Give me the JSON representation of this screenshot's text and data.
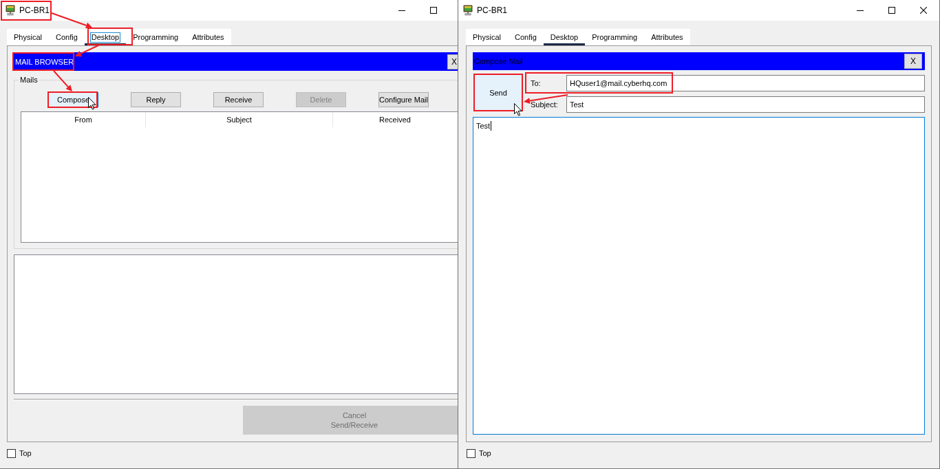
{
  "windows": [
    {
      "title": "PC-BR1",
      "partly_covered": true,
      "tabs": [
        {
          "label": "Physical",
          "selected": false,
          "focused": false
        },
        {
          "label": "Config",
          "selected": false,
          "focused": false
        },
        {
          "label": "Desktop",
          "selected": true,
          "focused": true
        },
        {
          "label": "Programming",
          "selected": false,
          "focused": false
        },
        {
          "label": "Attributes",
          "selected": false,
          "focused": false
        }
      ],
      "app": {
        "kind": "mail_browser",
        "title": "MAIL BROWSER",
        "close_label": "X",
        "group_label": "Mails",
        "buttons": [
          {
            "label": "Compose",
            "disabled": false,
            "hovered": true
          },
          {
            "label": "Reply",
            "disabled": false,
            "hovered": false
          },
          {
            "label": "Receive",
            "disabled": false,
            "hovered": false
          },
          {
            "label": "Delete",
            "disabled": true,
            "hovered": false
          },
          {
            "label": "Configure Mail",
            "disabled": false,
            "hovered": false
          }
        ],
        "columns": [
          "From",
          "Subject",
          "Received"
        ],
        "cancel_button": {
          "label": "Cancel\nSend/Receive",
          "disabled": true
        }
      },
      "top_checkbox": {
        "label": "Top",
        "checked": false
      }
    },
    {
      "title": "PC-BR1",
      "partly_covered": false,
      "tabs": [
        {
          "label": "Physical",
          "selected": false,
          "focused": false
        },
        {
          "label": "Config",
          "selected": false,
          "focused": false
        },
        {
          "label": "Desktop",
          "selected": true,
          "focused": false
        },
        {
          "label": "Programming",
          "selected": false,
          "focused": false
        },
        {
          "label": "Attributes",
          "selected": false,
          "focused": false
        }
      ],
      "app": {
        "kind": "compose_mail",
        "title": "Compose Mail",
        "close_label": "X",
        "send_button": {
          "label": "Send",
          "hovered": true
        },
        "fields": [
          {
            "label": "To:",
            "value": "HQuser1@mail.cyberhq.com"
          },
          {
            "label": "Subject:",
            "value": "Test"
          }
        ],
        "body": {
          "text": "Test",
          "focused": true
        }
      },
      "top_checkbox": {
        "label": "Top",
        "checked": false
      }
    }
  ],
  "annotations": [
    {
      "kind": "frame"
    },
    {
      "kind": "arrow"
    },
    {
      "kind": "frame"
    },
    {
      "kind": "arrow"
    },
    {
      "kind": "frame"
    },
    {
      "kind": "arrow"
    },
    {
      "kind": "frame"
    },
    {
      "kind": "frame"
    },
    {
      "kind": "frame"
    },
    {
      "kind": "arrow"
    }
  ]
}
